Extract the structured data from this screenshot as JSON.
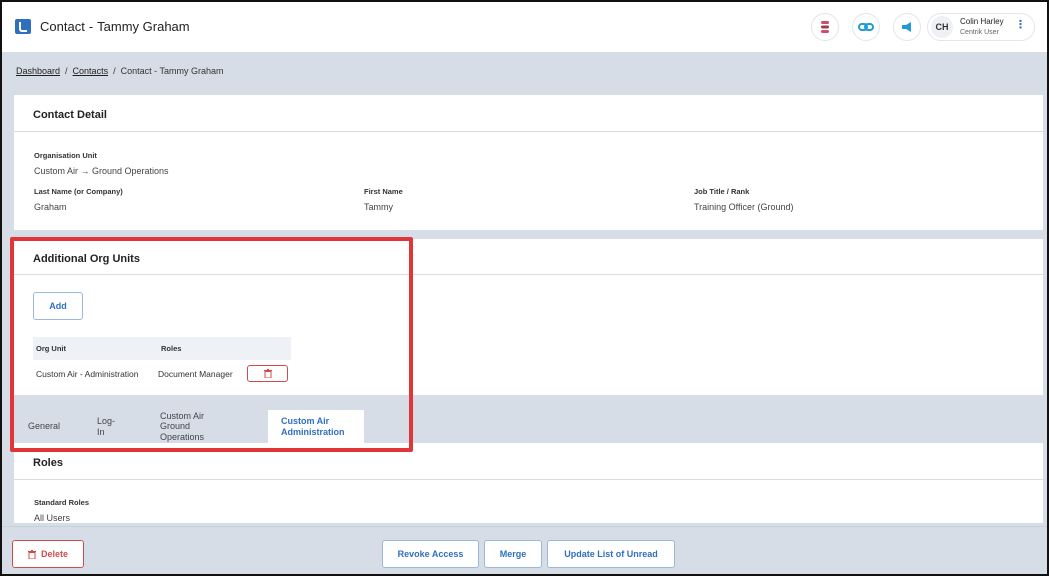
{
  "header": {
    "title_entity": "Contact",
    "title_separator": "-",
    "title_name": "Tammy Graham",
    "buttons": [
      {
        "icon": "stack-icon",
        "color": "#d24b6a"
      },
      {
        "icon": "link-icon",
        "color": "#1f9bd7"
      },
      {
        "icon": "megaphone-icon",
        "color": "#1f9bd7"
      }
    ],
    "user": {
      "initials": "CH",
      "name": "Colin Harley",
      "role": "Centrik User",
      "menu_icon": "⋮"
    }
  },
  "breadcrumb": {
    "items": [
      "Dashboard",
      "Contacts",
      "Contact - Tammy Graham"
    ],
    "separator": "/"
  },
  "contact_detail": {
    "title": "Contact Detail",
    "org_unit_label": "Organisation Unit",
    "org_unit_value": "Custom Air → Ground Operations",
    "last_name_label": "Last Name (or Company)",
    "last_name_value": "Graham",
    "first_name_label": "First Name",
    "first_name_value": "Tammy",
    "job_title_label": "Job Title / Rank",
    "job_title_value": "Training Officer (Ground)"
  },
  "additional_org_units": {
    "title": "Additional Org Units",
    "add_label": "Add",
    "columns": [
      "Org Unit",
      "Roles"
    ],
    "rows": [
      {
        "org_unit": "Custom Air - Administration",
        "roles": "Document Manager"
      }
    ]
  },
  "tabs": [
    {
      "label": "General"
    },
    {
      "label": "Log-In"
    },
    {
      "line1": "Custom Air",
      "line2": "Ground Operations"
    },
    {
      "line1": "Custom Air",
      "line2": "Administration",
      "active": true
    }
  ],
  "roles": {
    "title": "Roles",
    "standard_roles_label": "Standard Roles",
    "standard_roles_value": "All Users"
  },
  "footer": {
    "delete_label": "Delete",
    "revoke_label": "Revoke Access",
    "merge_label": "Merge",
    "update_label": "Update List of Unread"
  },
  "colors": {
    "accent": "#2f6fbf",
    "danger": "#d24b4b",
    "highlight": "#e0363a"
  }
}
